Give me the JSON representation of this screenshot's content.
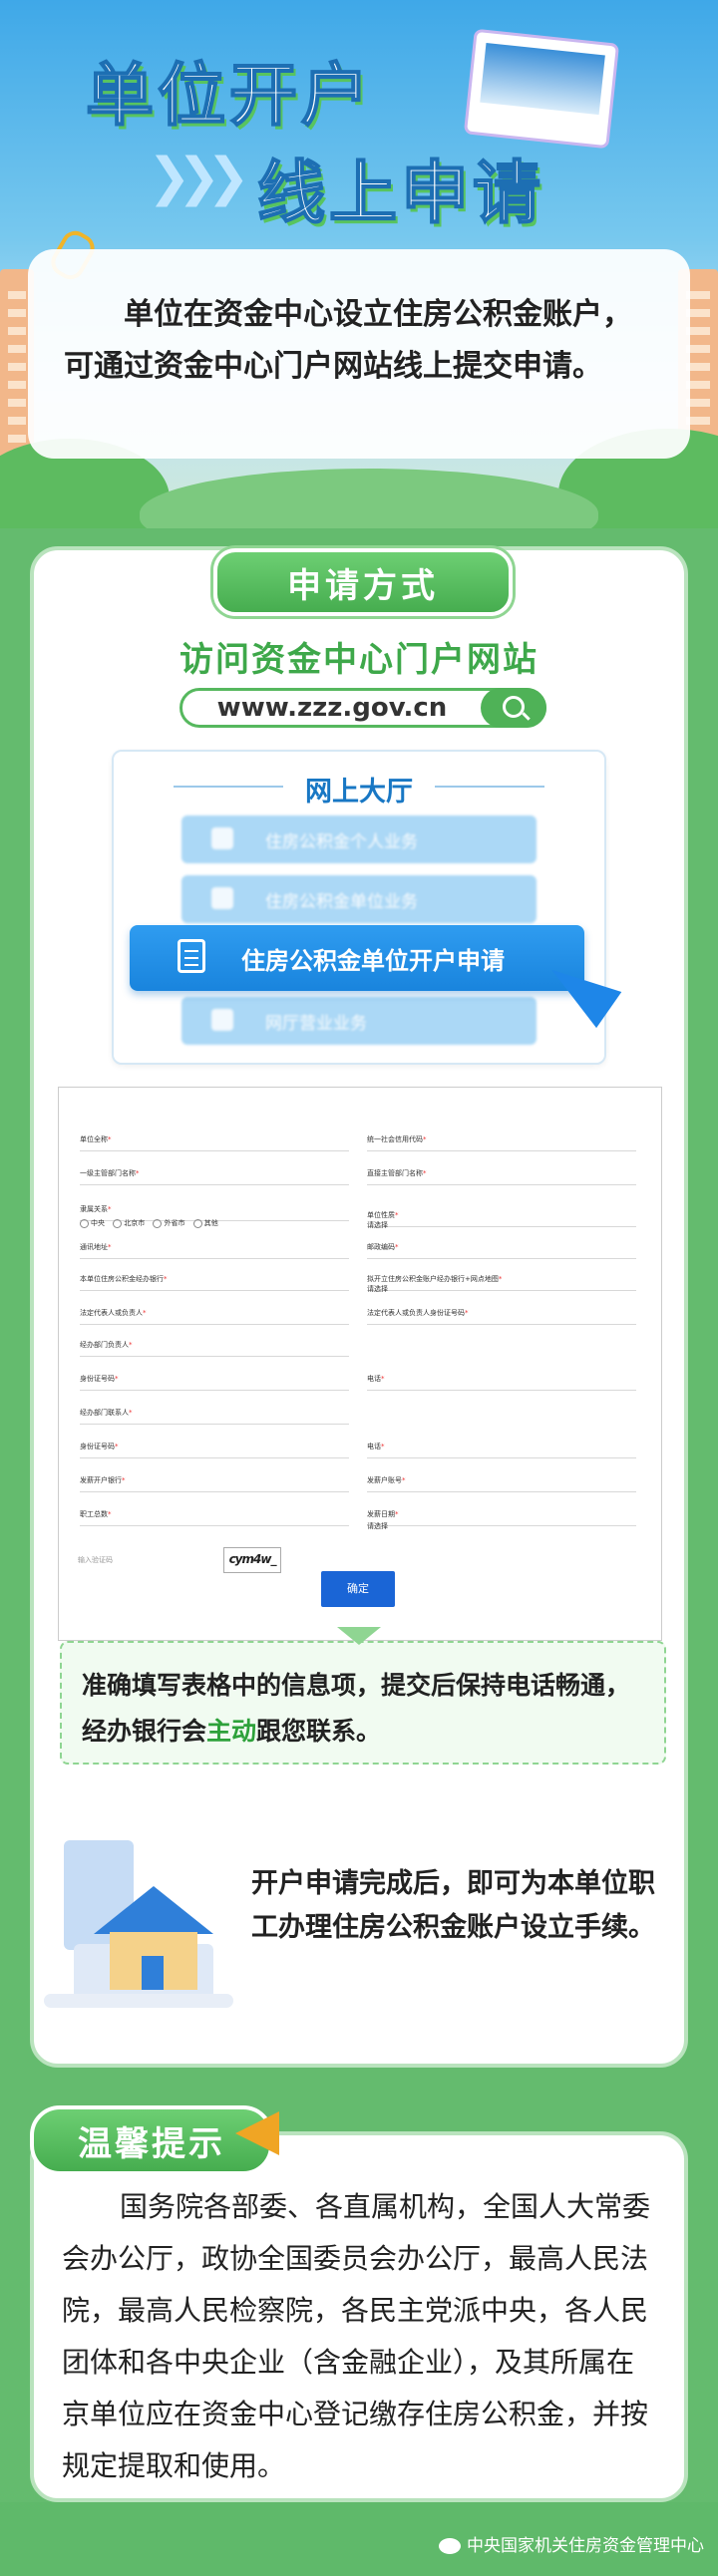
{
  "hero": {
    "title_line1": "单位开户",
    "title_line2": "线上申请"
  },
  "intro": {
    "text": "单位在资金中心设立住房公积金账户，可通过资金中心门户网站线上提交申请。"
  },
  "method": {
    "badge": "申请方式",
    "heading": "访问资金中心门户网站",
    "url": "www.zzz.gov.cn",
    "hall": {
      "title": "网上大厅",
      "faded_items": [
        "住房公积金个人业务",
        "住房公积金单位业务",
        "网厅营业业务"
      ],
      "active_item": "住房公积金单位开户申请"
    }
  },
  "form": {
    "fields_left": [
      "单位全称",
      "一级主管部门名称",
      "隶属关系",
      "通讯地址",
      "本单位住房公积金经办银行",
      "法定代表人或负责人",
      "经办部门负责人",
      "身份证号码",
      "经办部门联系人",
      "身份证号码",
      "发薪开户银行",
      "职工总数"
    ],
    "fields_right": [
      "统一社会信用代码",
      "直接主管部门名称",
      "单位性质",
      "邮政编码",
      "拟开立住房公积金账户经办银行+网点地图",
      "法定代表人或负责人身份证号码",
      "",
      "电话",
      "",
      "电话",
      "发薪户账号",
      "发薪日期"
    ],
    "radio_options": [
      "中央",
      "北京市",
      "外省市",
      "其他"
    ],
    "select_placeholder": "请选择",
    "captcha_placeholder": "输入验证码",
    "captcha_text": "cym4w_",
    "submit_label": "确定"
  },
  "note": {
    "part1": "准确填写表格中的信息项，提交后保持电话畅通，经办银行会",
    "highlight": "主动",
    "part2": "跟您联系。"
  },
  "result": {
    "text": "开户申请完成后，即可为本单位职工办理住房公积金账户设立手续。"
  },
  "tips": {
    "badge": "温馨提示",
    "text": "国务院各部委、各直属机构，全国人大常委会办公厅，政协全国委员会办公厅，最高人民法院，最高人民检察院，各民主党派中央，各人民团体和各中央企业（含金融企业），及其所属在京单位应在资金中心登记缴存住房公积金，并按规定提取和使用。"
  },
  "footer": {
    "text": "中央国家机关住房资金管理中心"
  },
  "colors": {
    "green": "#64bb6e",
    "blue": "#1877c4",
    "accent": "#2da13a"
  }
}
